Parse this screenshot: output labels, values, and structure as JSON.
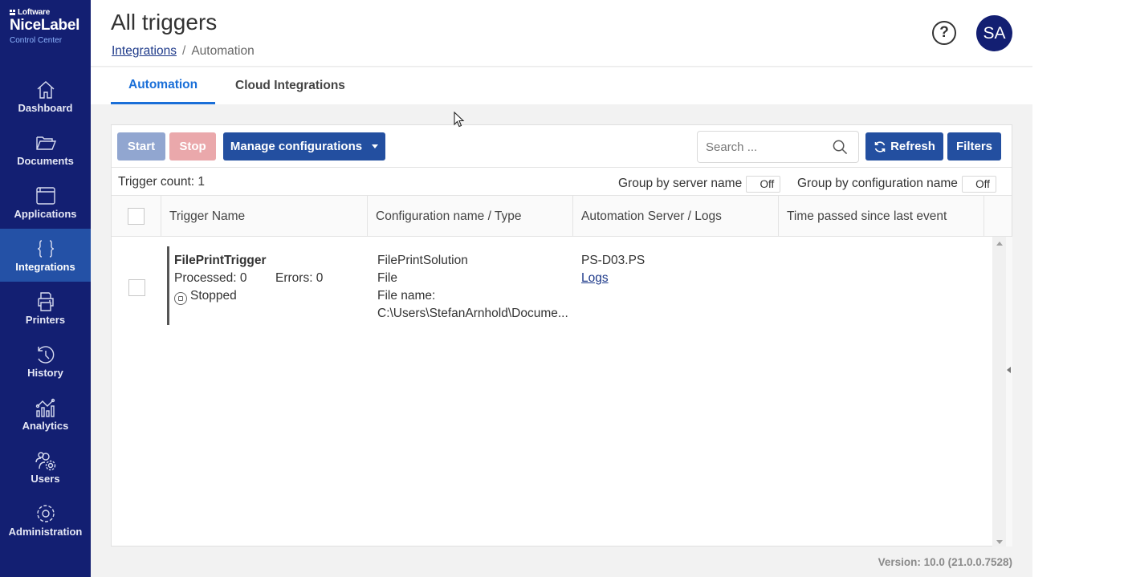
{
  "brand": {
    "company": "Loftware",
    "product": "NiceLabel",
    "subtitle": "Control Center"
  },
  "sidebar": {
    "items": [
      {
        "label": "Dashboard",
        "icon": "home-icon",
        "active": false
      },
      {
        "label": "Documents",
        "icon": "folder-icon",
        "active": false
      },
      {
        "label": "Applications",
        "icon": "window-icon",
        "active": false
      },
      {
        "label": "Integrations",
        "icon": "braces-icon",
        "active": true
      },
      {
        "label": "Printers",
        "icon": "printer-icon",
        "active": false
      },
      {
        "label": "History",
        "icon": "history-icon",
        "active": false
      },
      {
        "label": "Analytics",
        "icon": "analytics-icon",
        "active": false
      },
      {
        "label": "Users",
        "icon": "users-gear-icon",
        "active": false
      },
      {
        "label": "Administration",
        "icon": "gear-icon",
        "active": false
      }
    ]
  },
  "header": {
    "title": "All triggers",
    "breadcrumb": {
      "link": "Integrations",
      "separator": "/",
      "current": "Automation"
    },
    "help_label": "?",
    "avatar_initials": "SA"
  },
  "tabs": [
    {
      "label": "Automation",
      "active": true
    },
    {
      "label": "Cloud Integrations",
      "active": false
    }
  ],
  "toolbar": {
    "start_label": "Start",
    "stop_label": "Stop",
    "manage_label": "Manage configurations",
    "search_placeholder": "Search ...",
    "search_value": "",
    "refresh_label": "Refresh",
    "filters_label": "Filters"
  },
  "countbar": {
    "trigger_count": "Trigger count: 1",
    "group_server_label": "Group by server name",
    "group_server_value": "Off",
    "group_config_label": "Group by configuration name",
    "group_config_value": "Off"
  },
  "table": {
    "columns": [
      "Trigger Name",
      "Configuration name / Type",
      "Automation Server / Logs",
      "Time passed since last event"
    ],
    "rows": [
      {
        "name": "FilePrintTrigger",
        "processed": "Processed: 0",
        "errors": "Errors: 0",
        "status": "Stopped",
        "configuration": "FilePrintSolution",
        "type": "File",
        "file_label": "File name:",
        "file_path": "C:\\Users\\StefanArnhold\\Docume...",
        "server": "PS-D03.PS",
        "logs_label": "Logs",
        "time_passed": ""
      }
    ]
  },
  "footer": {
    "version": "Version: 10.0 (21.0.0.7528)"
  },
  "colors": {
    "sidebar_bg": "#131f72",
    "sidebar_active": "#2451a6",
    "primary_button": "#234fa0",
    "tab_active": "#1a6fd8",
    "start_disabled": "#91a6d0",
    "stop_disabled": "#eaa8ab"
  }
}
